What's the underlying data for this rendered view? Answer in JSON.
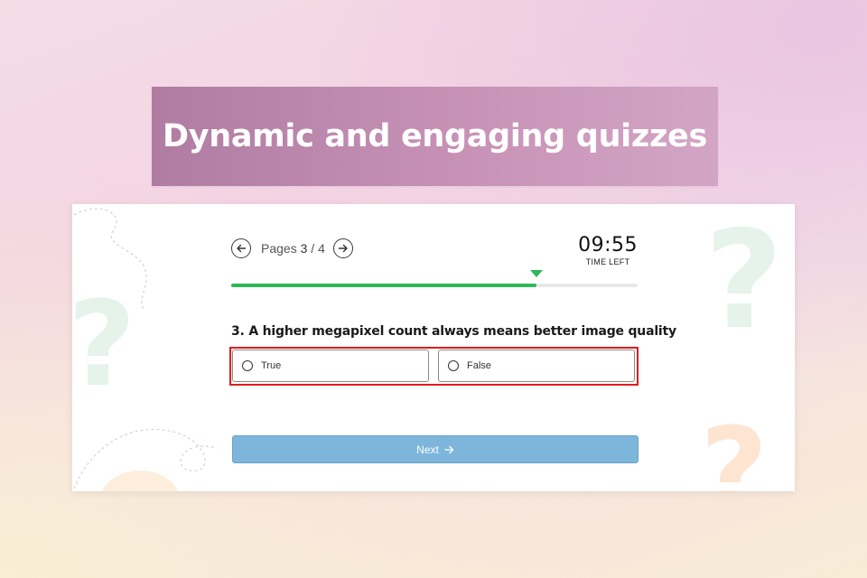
{
  "banner": {
    "title": "Dynamic and engaging quizzes"
  },
  "quiz": {
    "pages_prefix": "Pages",
    "current_page": "3",
    "separator": "/",
    "total_pages": "4",
    "timer": {
      "value": "09:55",
      "label": "TIME LEFT"
    },
    "progress_fraction": 0.75,
    "question": "3. A higher megapixel count always means better image quality",
    "options": [
      {
        "label": "True",
        "selected": false
      },
      {
        "label": "False",
        "selected": false
      }
    ],
    "next_button": {
      "label": "Next",
      "icon": "arrow-right-icon"
    },
    "prev_icon": "arrow-left-icon",
    "forward_icon": "arrow-right-icon"
  },
  "colors": {
    "banner": "#b07ca2",
    "progress": "#2fb85a",
    "highlight": "#e11b1b",
    "next_button": "#7db6da"
  }
}
